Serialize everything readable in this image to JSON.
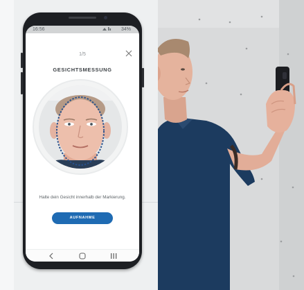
{
  "status_bar": {
    "time": "16:56",
    "icons_text": "34%"
  },
  "app": {
    "step": "1/5",
    "title": "GESICHTSMESSUNG",
    "hint": "Halte dein Gesicht innerhalb der Markierung.",
    "capture_button": "AUFNAHME"
  },
  "icons": {
    "close": "close-icon",
    "back": "nav-back-icon",
    "home": "nav-home-icon",
    "recents": "nav-recents-icon"
  },
  "colors": {
    "accent": "#1f6bb3",
    "face_marker": "#28508c",
    "shirt": "#1c3b5f"
  }
}
